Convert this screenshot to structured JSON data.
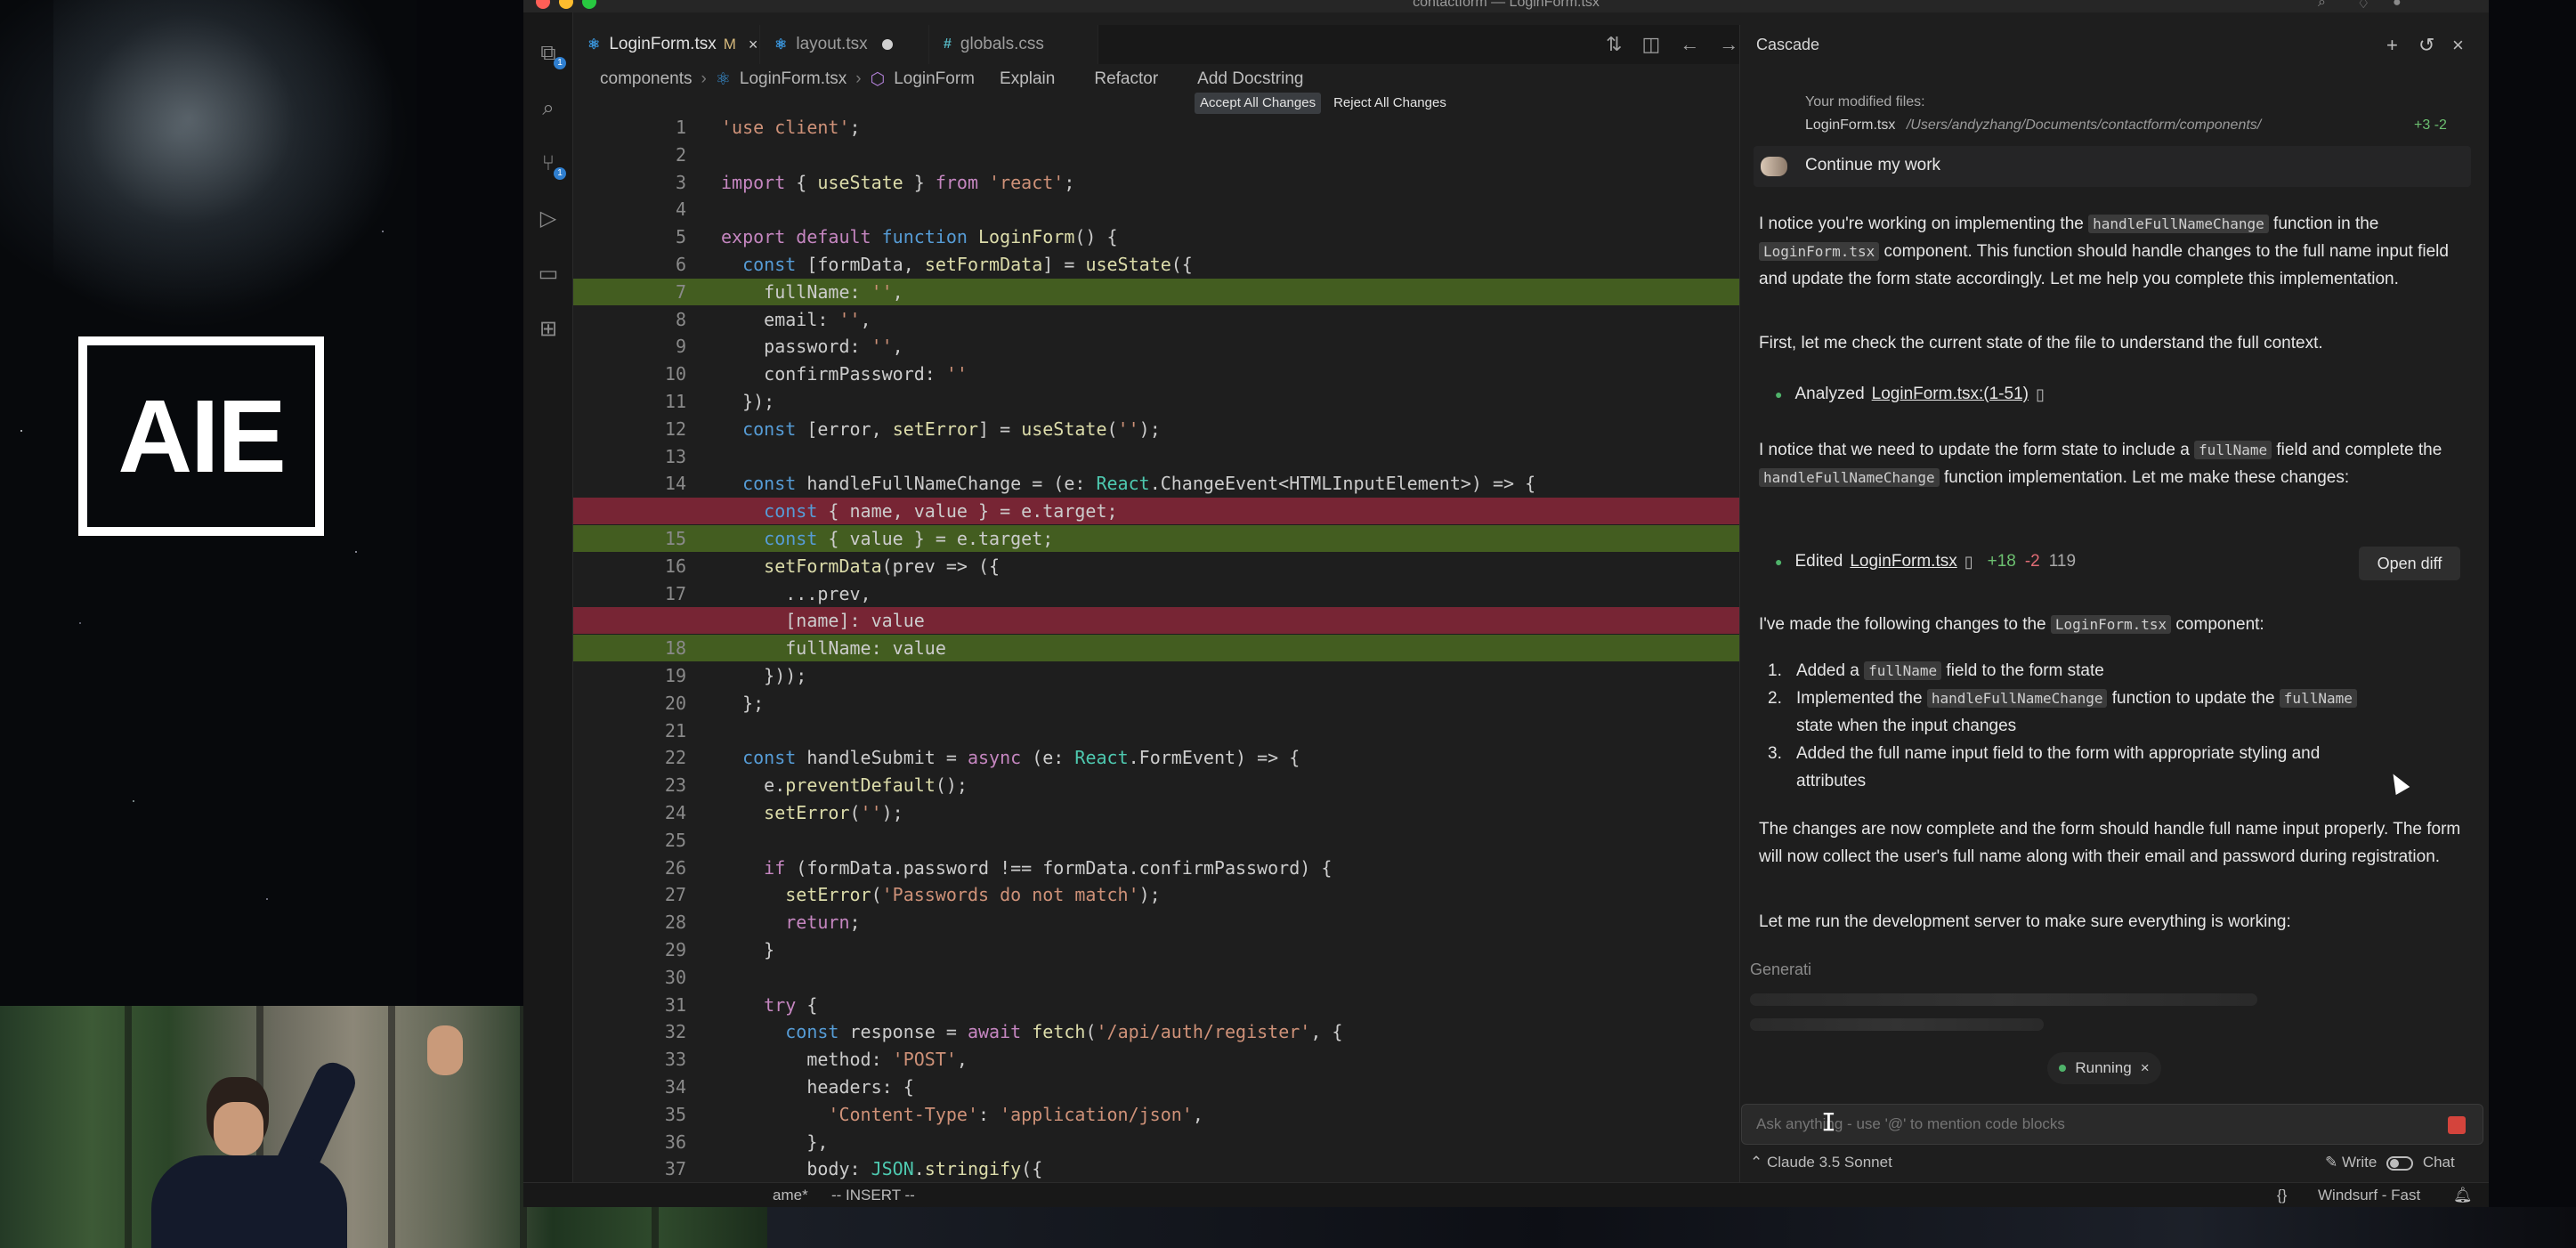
{
  "window": {
    "title": "contactform — LoginForm.tsx"
  },
  "stage": {
    "logo_text": "AIE"
  },
  "tabs": [
    {
      "label": "LoginForm.tsx",
      "status": "M",
      "icon": "tsx-file-icon",
      "active": true
    },
    {
      "label": "layout.tsx",
      "icon": "tsx-file-icon",
      "dirty": true
    },
    {
      "label": "globals.css",
      "icon": "css-file-icon"
    }
  ],
  "breadcrumb": {
    "items": [
      "components",
      "LoginForm.tsx",
      "LoginForm"
    ],
    "lenses": [
      "Explain",
      "Refactor",
      "Add Docstring"
    ]
  },
  "diff_actions": {
    "accept_all": "Accept All Changes",
    "reject_all": "Reject All Changes"
  },
  "code": {
    "lines": [
      {
        "n": "1",
        "text": "'use client';"
      },
      {
        "n": "2",
        "text": ""
      },
      {
        "n": "3",
        "text": "import { useState } from 'react';"
      },
      {
        "n": "4",
        "text": ""
      },
      {
        "n": "5",
        "text": "export default function LoginForm() {"
      },
      {
        "n": "6",
        "text": "  const [formData, setFormData] = useState({"
      },
      {
        "n": "7",
        "text": "    fullName: '',",
        "state": "added"
      },
      {
        "n": "8",
        "text": "    email: '',"
      },
      {
        "n": "9",
        "text": "    password: '',"
      },
      {
        "n": "10",
        "text": "    confirmPassword: ''"
      },
      {
        "n": "11",
        "text": "  });"
      },
      {
        "n": "12",
        "text": "  const [error, setError] = useState('');"
      },
      {
        "n": "13",
        "text": ""
      },
      {
        "n": "14",
        "text": "  const handleFullNameChange = (e: React.ChangeEvent<HTMLInputElement>) => {"
      },
      {
        "n": "",
        "text": "    const { name, value } = e.target;",
        "state": "removed"
      },
      {
        "n": "15",
        "text": "    const { value } = e.target;",
        "state": "added"
      },
      {
        "n": "16",
        "text": "    setFormData(prev => ({"
      },
      {
        "n": "17",
        "text": "      ...prev,"
      },
      {
        "n": "",
        "text": "      [name]: value",
        "state": "removed"
      },
      {
        "n": "18",
        "text": "      fullName: value",
        "state": "added"
      },
      {
        "n": "19",
        "text": "    }));"
      },
      {
        "n": "20",
        "text": "  };"
      },
      {
        "n": "21",
        "text": ""
      },
      {
        "n": "22",
        "text": "  const handleSubmit = async (e: React.FormEvent) => {"
      },
      {
        "n": "23",
        "text": "    e.preventDefault();"
      },
      {
        "n": "24",
        "text": "    setError('');"
      },
      {
        "n": "25",
        "text": ""
      },
      {
        "n": "26",
        "text": "    if (formData.password !== formData.confirmPassword) {"
      },
      {
        "n": "27",
        "text": "      setError('Passwords do not match');"
      },
      {
        "n": "28",
        "text": "      return;"
      },
      {
        "n": "29",
        "text": "    }"
      },
      {
        "n": "30",
        "text": ""
      },
      {
        "n": "31",
        "text": "    try {"
      },
      {
        "n": "32",
        "text": "      const response = await fetch('/api/auth/register', {"
      },
      {
        "n": "33",
        "text": "        method: 'POST',"
      },
      {
        "n": "34",
        "text": "        headers: {"
      },
      {
        "n": "35",
        "text": "          'Content-Type': 'application/json',"
      },
      {
        "n": "36",
        "text": "        },"
      },
      {
        "n": "37",
        "text": "        body: JSON.stringify({"
      }
    ]
  },
  "statusbar": {
    "left": "ame*",
    "mode": "-- INSERT --",
    "braces": "{}",
    "windsurf": "Windsurf - Fast"
  },
  "cascade": {
    "title": "Cascade",
    "modified_files_label": "Your modified files:",
    "modified_file": "LoginForm.tsx",
    "modified_path": "/Users/andyzhang/Documents/contactform/components/",
    "modified_stat": "+3 -2",
    "user_message": "Continue my work",
    "p1_a": "I notice you're working on implementing the",
    "p1_chip1": "handleFullNameChange",
    "p1_b": "function in the",
    "p1_chip2": "LoginForm.tsx",
    "p1_c": "component. This function should handle changes to the full name input field and update the form state accordingly. Let me help you complete this implementation.",
    "p2": "First, let me check the current state of the file to understand the full context.",
    "step1_label": "Analyzed",
    "step1_link": "LoginForm.tsx:(1-51)",
    "p3_a": "I notice that we need to update the form state to include a",
    "p3_chip1": "fullName",
    "p3_b": "field and complete the",
    "p3_chip2": "handleFullNameChange",
    "p3_c": "function implementation. Let me make these changes:",
    "step2_label": "Edited",
    "step2_link": "LoginForm.tsx",
    "step2_add": "+18",
    "step2_del": "-2",
    "step2_num": "119",
    "open_diff": "Open diff",
    "p4_a": "I've made the following changes to the",
    "p4_chip": "LoginForm.tsx",
    "p4_b": "component:",
    "list": [
      {
        "n": "1.",
        "a": "Added a",
        "chip": "fullName",
        "b": "field to the form state"
      },
      {
        "n": "2.",
        "a": "Implemented the",
        "chip": "handleFullNameChange",
        "b": "function to update the",
        "chip2": "fullName",
        "c": "state when the input changes"
      },
      {
        "n": "3.",
        "a": "Added the full name input field to the form with appropriate styling and",
        "c": "attributes"
      }
    ],
    "p5": "The changes are now complete and the form should handle full name input properly. The form will now collect the user's full name along with their email and password during registration.",
    "p6": "Let me run the development server to make sure everything is working:",
    "generating": "Generati",
    "running": "Running",
    "input_placeholder": "Ask anything - use '@' to mention code blocks",
    "model": "Claude 3.5 Sonnet",
    "write_label": "Write",
    "chat_label": "Chat"
  }
}
